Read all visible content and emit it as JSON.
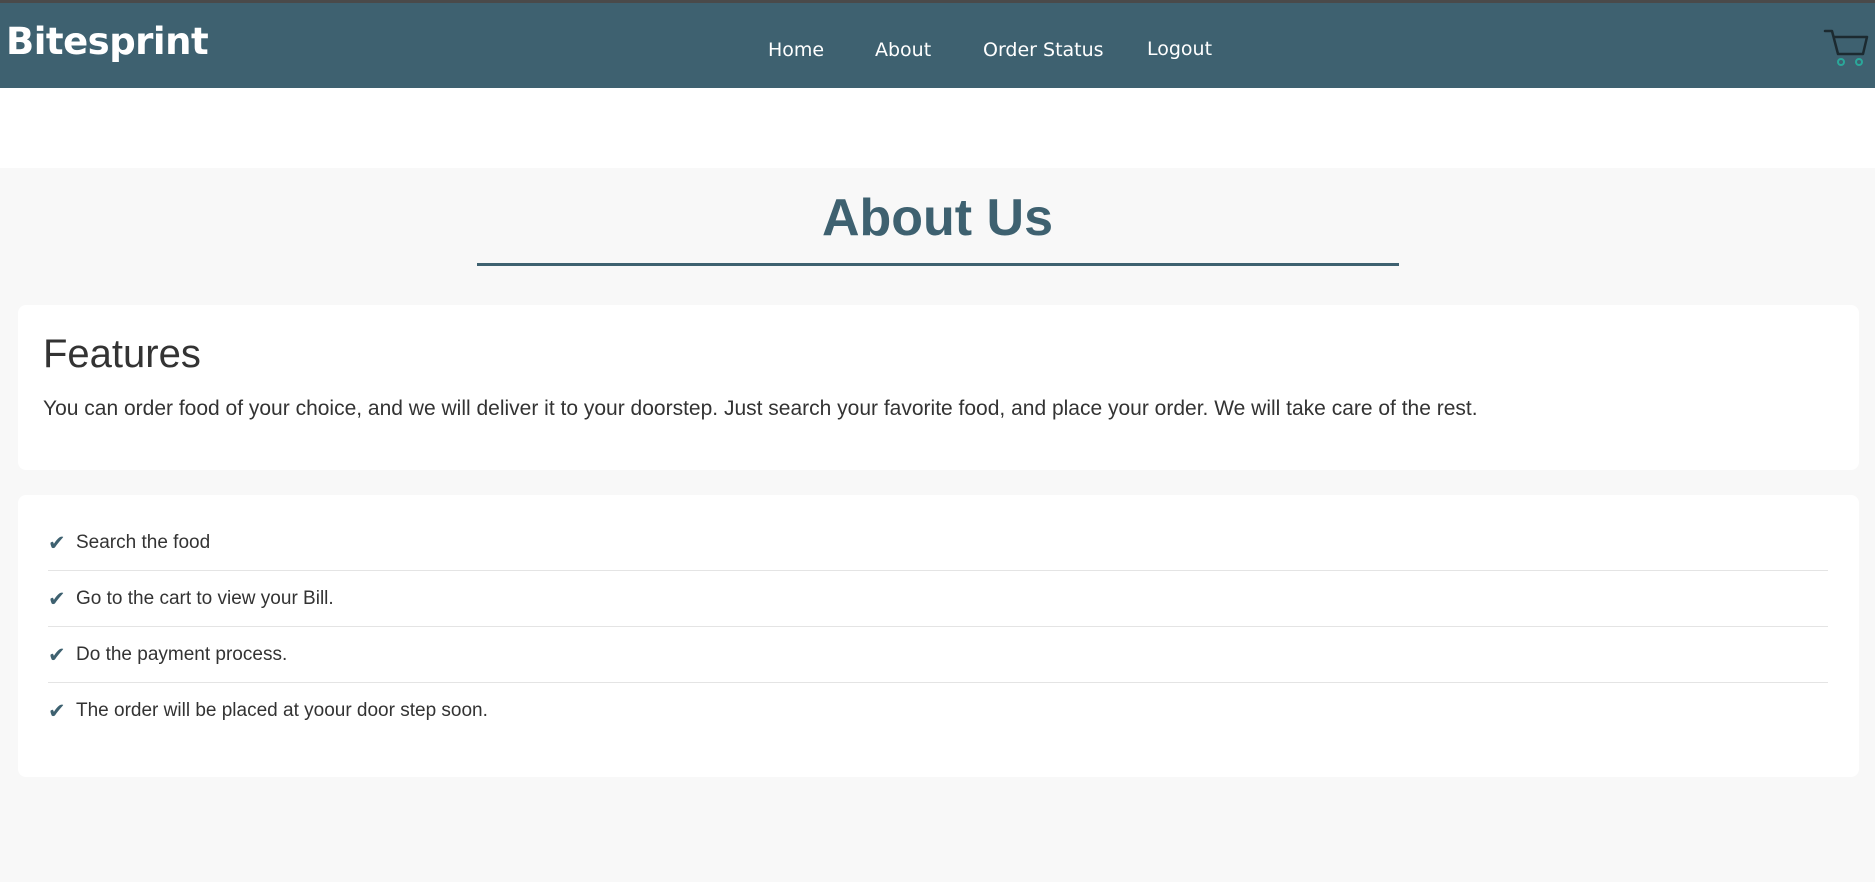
{
  "navbar": {
    "brand": "Bitesprint",
    "links": [
      {
        "label": "Home"
      },
      {
        "label": "About"
      },
      {
        "label": "Order Status"
      },
      {
        "label": "Logout"
      }
    ],
    "cart_icon": "cart-icon"
  },
  "page": {
    "title": "About Us"
  },
  "features": {
    "heading": "Features",
    "text": "You can order food of your choice, and we will deliver it to your doorstep. Just search your favorite food, and place your order. We will take care of the rest."
  },
  "steps": [
    {
      "icon": "check-icon",
      "text": "Search the food"
    },
    {
      "icon": "check-icon",
      "text": "Go to the cart to view your Bill."
    },
    {
      "icon": "check-icon",
      "text": "Do the payment process."
    },
    {
      "icon": "check-icon",
      "text": "The order will be placed at yoour door step soon."
    }
  ],
  "colors": {
    "navbar": "#3e6170",
    "accent": "#3e6170",
    "page_background": "#f8f8f8",
    "card_background": "#ffffff"
  }
}
